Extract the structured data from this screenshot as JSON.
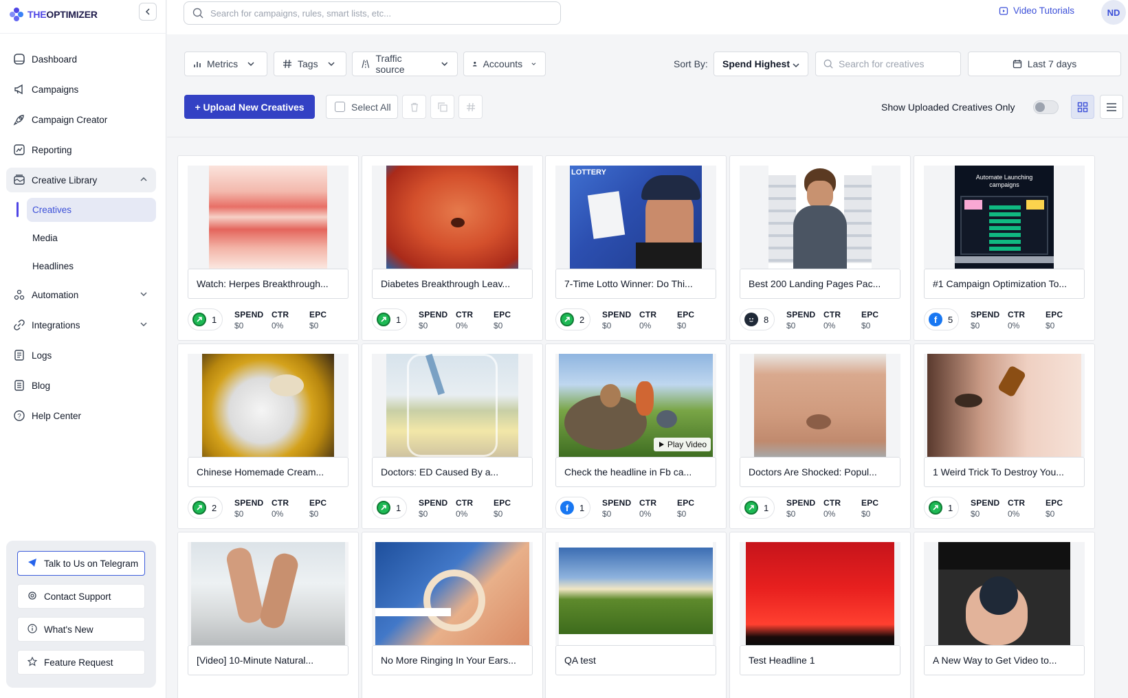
{
  "brand": {
    "name_prefix": "THE",
    "name_main": "OPTIMIZER"
  },
  "topbar": {
    "search_placeholder": "Search for campaigns, rules, smart lists, etc...",
    "video_tutorials": "Video Tutorials",
    "avatar_initials": "ND"
  },
  "sidebar": {
    "items": [
      {
        "label": "Dashboard",
        "icon": "dashboard-icon"
      },
      {
        "label": "Campaigns",
        "icon": "megaphone-icon"
      },
      {
        "label": "Campaign Creator",
        "icon": "rocket-icon"
      },
      {
        "label": "Reporting",
        "icon": "chart-icon"
      },
      {
        "label": "Creative Library",
        "icon": "library-icon"
      }
    ],
    "sub_items": [
      "Creatives",
      "Media",
      "Headlines"
    ],
    "items_after": [
      {
        "label": "Automation",
        "icon": "automation-icon"
      },
      {
        "label": "Integrations",
        "icon": "link-icon"
      },
      {
        "label": "Logs",
        "icon": "logs-icon"
      },
      {
        "label": "Blog",
        "icon": "blog-icon"
      },
      {
        "label": "Help Center",
        "icon": "help-icon"
      }
    ],
    "help": {
      "telegram": "Talk to Us on Telegram",
      "support": "Contact Support",
      "whats_new": "What's New",
      "feature": "Feature Request"
    }
  },
  "toolbar": {
    "metrics": "Metrics",
    "tags": "Tags",
    "traffic_source": "Traffic source",
    "accounts": "Accounts",
    "sort_by_label": "Sort By:",
    "sort_value": "Spend Highest",
    "creative_search_placeholder": "Search for creatives",
    "date_range": "Last 7 days",
    "upload": "+ Upload New Creatives",
    "select_all": "Select All",
    "show_uploaded": "Show Uploaded Creatives Only"
  },
  "metric_labels": {
    "spend": "SPEND",
    "ctr": "CTR",
    "epc": "EPC"
  },
  "cards": [
    {
      "headline": "Watch: Herpes Breakthrough...",
      "source": "green",
      "count": "1",
      "spend": "$0",
      "ctr": "0%",
      "epc": "$0"
    },
    {
      "headline": "Diabetes Breakthrough Leav...",
      "source": "green",
      "count": "1",
      "spend": "$0",
      "ctr": "0%",
      "epc": "$0"
    },
    {
      "headline": "7-Time Lotto Winner: Do Thi...",
      "source": "green",
      "count": "2",
      "spend": "$0",
      "ctr": "0%",
      "epc": "$0"
    },
    {
      "headline": "Best 200 Landing Pages Pac...",
      "source": "dark",
      "count": "8",
      "spend": "$0",
      "ctr": "0%",
      "epc": "$0"
    },
    {
      "headline": "#1 Campaign Optimization To...",
      "source": "fb",
      "count": "5",
      "spend": "$0",
      "ctr": "0%",
      "epc": "$0"
    },
    {
      "headline": "Chinese Homemade Cream...",
      "source": "green",
      "count": "2",
      "spend": "$0",
      "ctr": "0%",
      "epc": "$0"
    },
    {
      "headline": "Doctors: ED Caused By a...",
      "source": "green",
      "count": "1",
      "spend": "$0",
      "ctr": "0%",
      "epc": "$0"
    },
    {
      "headline": "Check the headline in Fb ca...",
      "source": "fb",
      "count": "1",
      "spend": "$0",
      "ctr": "0%",
      "epc": "$0",
      "play": "Play Video"
    },
    {
      "headline": "Doctors Are Shocked: Popul...",
      "source": "green",
      "count": "1",
      "spend": "$0",
      "ctr": "0%",
      "epc": "$0"
    },
    {
      "headline": "1 Weird Trick To Destroy You...",
      "source": "green",
      "count": "1",
      "spend": "$0",
      "ctr": "0%",
      "epc": "$0"
    },
    {
      "headline": "[Video] 10-Minute Natural..."
    },
    {
      "headline": "No More Ringing In Your Ears..."
    },
    {
      "headline": "QA test"
    },
    {
      "headline": "Test Headline 1"
    },
    {
      "headline": "A New Way to Get Video to..."
    }
  ],
  "thumb_text": {
    "automate": "Automate Launching campaigns",
    "lottery": "LOTTERY"
  },
  "colors": {
    "primary": "#3341c4",
    "accent": "#3b4fd8",
    "green": "#1db954",
    "facebook": "#1877f2"
  }
}
